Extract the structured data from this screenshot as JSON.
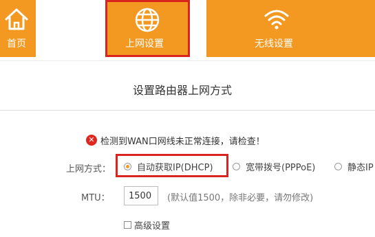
{
  "nav": {
    "home_label": "首页",
    "wan_label": "上网设置",
    "wifi_label": "无线设置",
    "home_icon": "house-icon",
    "wan_icon": "globe-icon",
    "wifi_icon": "wifi-icon",
    "accent_color": "#f39820",
    "highlight_color": "#d9231f"
  },
  "main": {
    "title": "设置路由器上网方式",
    "error_icon": "error-x-icon",
    "error_text": "检测到WAN口网线未正常连接，请检查！",
    "mode_label": "上网方式：",
    "mode_options": [
      {
        "label": "自动获取IP(DHCP)",
        "selected": true
      },
      {
        "label": "宽带拨号(PPPoE)",
        "selected": false
      },
      {
        "label": "静态IP",
        "selected": false
      }
    ],
    "mtu_label": "MTU：",
    "mtu_value": "1500",
    "mtu_hint": "(默认值1500，除非必要，请勿修改)",
    "advanced_label": "高级设置",
    "advanced_checked": false
  }
}
